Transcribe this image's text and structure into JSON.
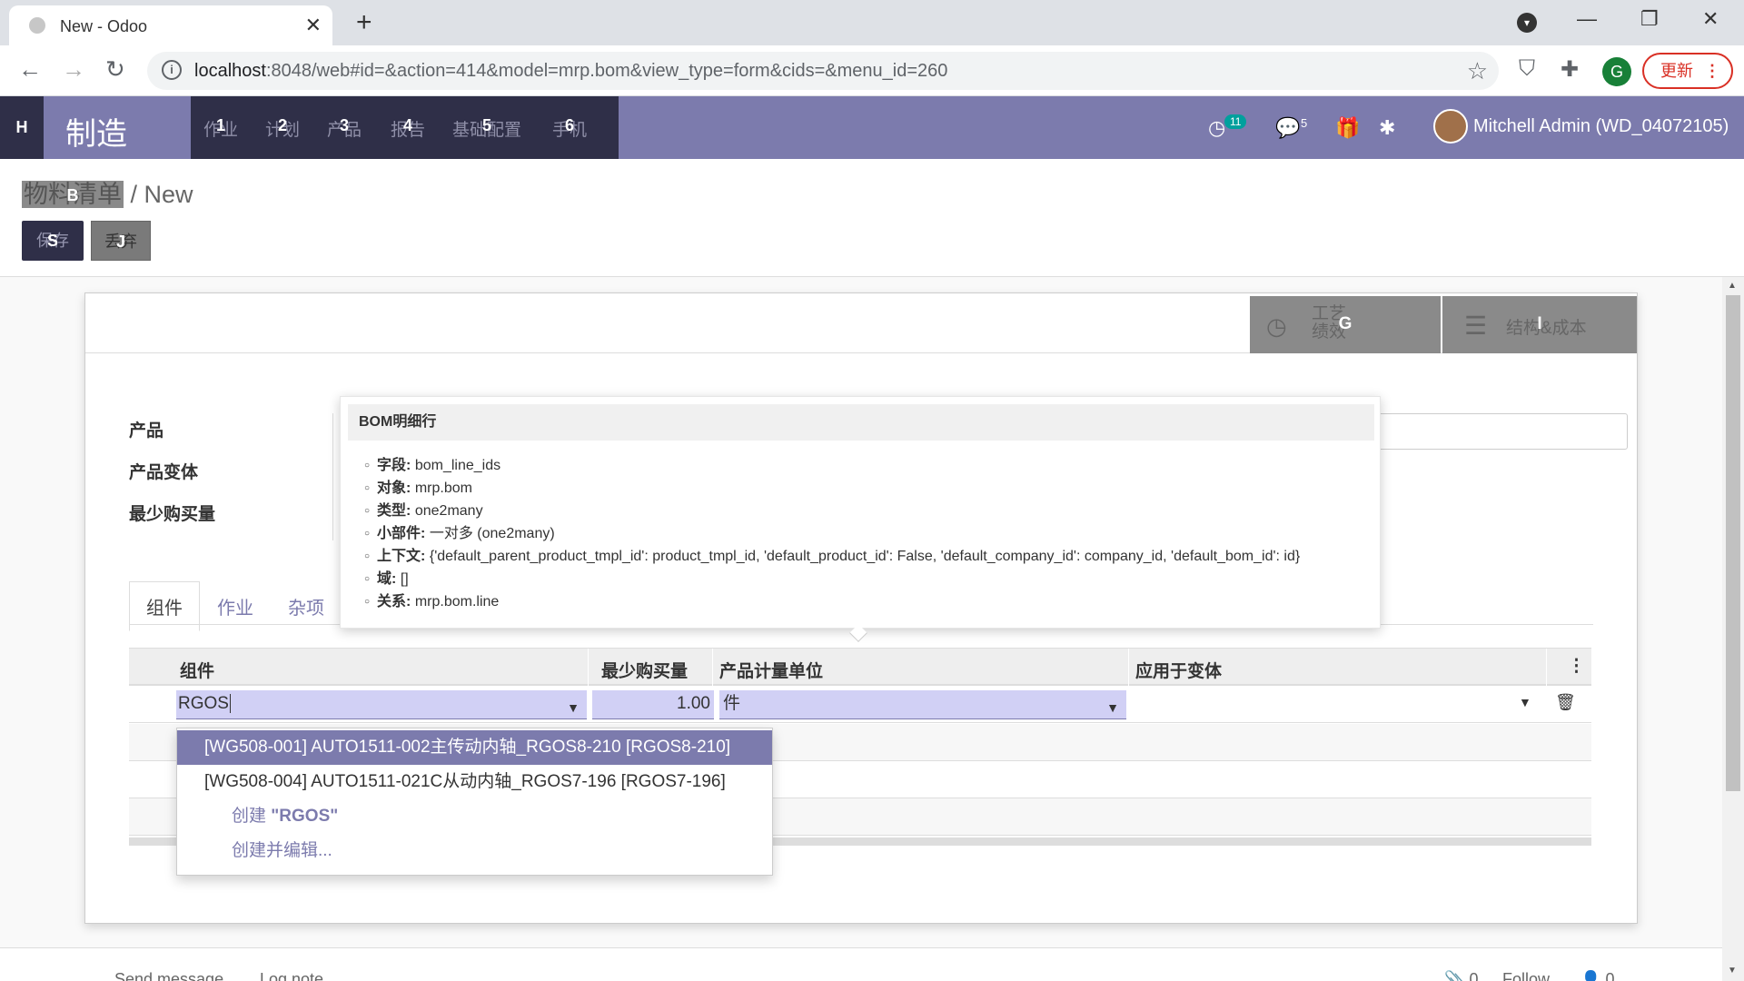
{
  "browser": {
    "tab_title": "New - Odoo",
    "url_host": "localhost",
    "url_path": ":8048/web#id=&action=414&model=mrp.bom&view_type=form&cids=&menu_id=260",
    "update_label": "更新",
    "profile_initial": "G"
  },
  "navbar": {
    "home_hint": "H",
    "brand": "制造",
    "menus": [
      {
        "label": "作业",
        "hint": "1"
      },
      {
        "label": "计划",
        "hint": "2"
      },
      {
        "label": "产品",
        "hint": "3"
      },
      {
        "label": "报告",
        "hint": "4"
      },
      {
        "label": "基础配置",
        "hint": "5"
      },
      {
        "label": "手机",
        "hint": "6"
      }
    ],
    "activity_count": "11",
    "message_count": "5",
    "user": "Mitchell Admin (WD_04072105)"
  },
  "control_panel": {
    "breadcrumb_parent": "物料清单",
    "breadcrumb_parent_hint": "B",
    "breadcrumb_sep": "/",
    "breadcrumb_current": "New",
    "save_label": "保存",
    "save_hint": "S",
    "discard_label": "丢弃",
    "discard_hint": "J"
  },
  "smart_buttons": {
    "operations_line1": "工艺",
    "operations_line2": "绩效",
    "operations_hint": "G",
    "structure_label": "结构&成本",
    "structure_hint": "I"
  },
  "form": {
    "labels": [
      "产品",
      "产品变体",
      "最少购买量"
    ],
    "tabs": [
      "组件",
      "作业",
      "杂项"
    ]
  },
  "table": {
    "headers": [
      "组件",
      "最少购买量",
      "产品计量单位",
      "应用于变体"
    ],
    "row": {
      "component": "RGOS",
      "quantity": "1.00",
      "uom": "件"
    }
  },
  "autocomplete": {
    "items": [
      "[WG508-001] AUTO1511-002主传动内轴_RGOS8-210 [RGOS8-210]",
      "[WG508-004] AUTO1511-021C从动内轴_RGOS7-196 [RGOS7-196]"
    ],
    "create_prefix": "创建 ",
    "create_term": "\"RGOS\"",
    "create_edit": "创建并编辑..."
  },
  "tooltip": {
    "title": "BOM明细行",
    "rows": [
      {
        "key": "字段:",
        "value": "bom_line_ids"
      },
      {
        "key": "对象:",
        "value": "mrp.bom"
      },
      {
        "key": "类型:",
        "value": "one2many"
      },
      {
        "key": "小部件:",
        "value": "一对多 (one2many)"
      },
      {
        "key": "上下文:",
        "value": "{'default_parent_product_tmpl_id': product_tmpl_id, 'default_product_id': False, 'default_company_id': company_id, 'default_bom_id': id}"
      },
      {
        "key": "域:",
        "value": "[]"
      },
      {
        "key": "关系:",
        "value": "mrp.bom.line"
      }
    ]
  },
  "chatter": {
    "send_message": "Send message",
    "log_note": "Log note",
    "attachments": "0",
    "follow": "Follow",
    "followers": "0"
  }
}
